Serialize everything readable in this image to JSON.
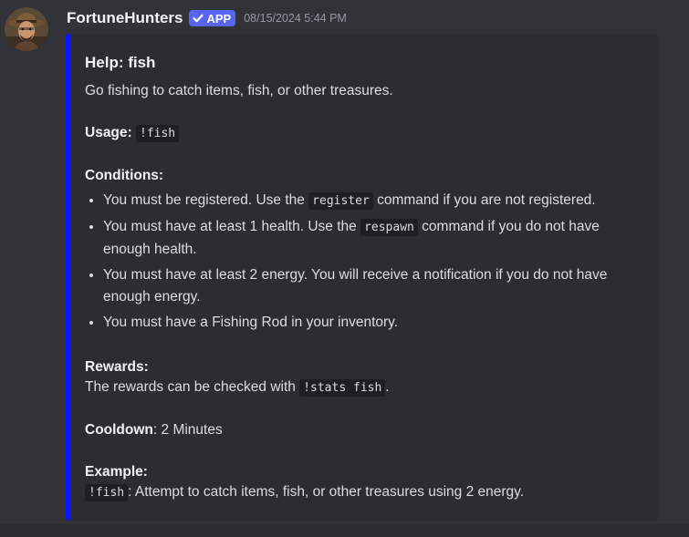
{
  "message": {
    "username": "FortuneHunters",
    "app_tag": "APP",
    "timestamp": "08/15/2024 5:44 PM"
  },
  "embed": {
    "accent_color": "#0a16f5",
    "title": "Help: fish",
    "description": "Go fishing to catch items, fish, or other treasures.",
    "usage_label": "Usage:",
    "usage_code": "!fish",
    "conditions_label": "Conditions:",
    "conditions": [
      {
        "before": "You must be registered. Use the ",
        "code": "register",
        "after": " command if you are not registered."
      },
      {
        "before": "You must have at least 1 health. Use the ",
        "code": "respawn",
        "after": " command if you do not have enough health."
      },
      {
        "text": "You must have at least 2 energy. You will receive a notification if you do not have enough energy."
      },
      {
        "text": "You must have a Fishing Rod in your inventory."
      }
    ],
    "rewards_label": "Rewards:",
    "rewards_text": "The rewards can be checked with ",
    "rewards_code": "!stats fish",
    "rewards_end": ".",
    "cooldown_label": "Cooldown",
    "cooldown_value": ": 2 Minutes",
    "example_label": "Example:",
    "example_code": "!fish",
    "example_text": ": Attempt to catch items, fish, or other treasures using 2 energy."
  },
  "icons": {
    "avatar": "cowboy-hunter-avatar",
    "verified": "check-icon"
  }
}
